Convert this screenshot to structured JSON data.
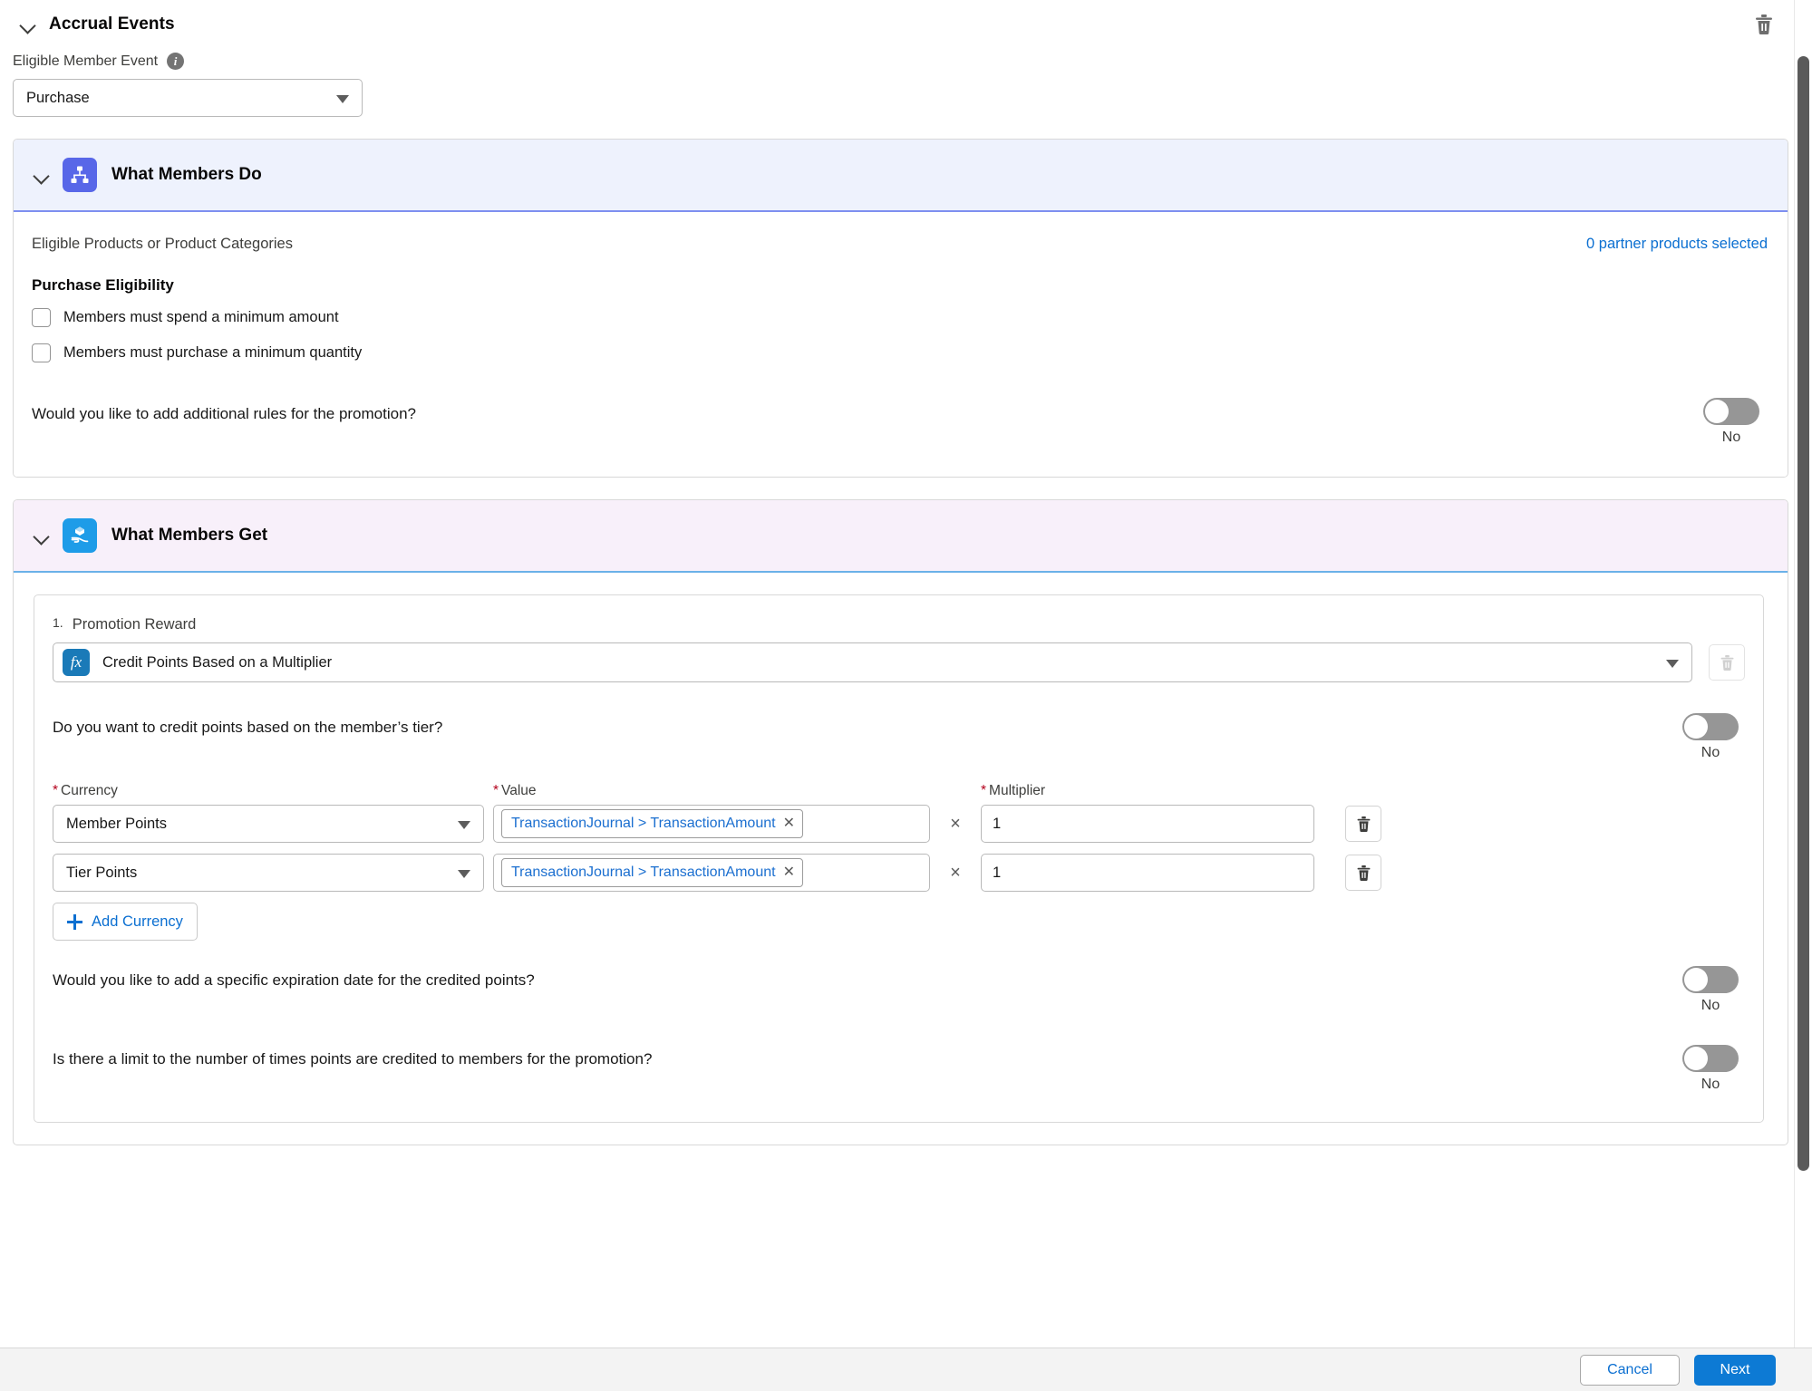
{
  "accrual": {
    "title": "Accrual Events",
    "delete_icon": "trash-icon",
    "chevron_icon": "chevron-down-icon"
  },
  "eligible_member_event": {
    "label": "Eligible Member Event",
    "info_icon": "info-icon",
    "value": "Purchase"
  },
  "what_members_do": {
    "title": "What Members Do",
    "icon": "hierarchy-icon",
    "eligible_products_label": "Eligible Products or Product Categories",
    "partner_products_link": "0 partner products selected",
    "purchase_eligibility_heading": "Purchase Eligibility",
    "checkboxes": [
      {
        "label": "Members must spend a minimum amount",
        "checked": false
      },
      {
        "label": "Members must purchase a minimum quantity",
        "checked": false
      }
    ],
    "additional_rules": {
      "question": "Would you like to add additional rules for the promotion?",
      "state": "No"
    }
  },
  "what_members_get": {
    "title": "What Members Get",
    "icon": "gift-in-hand-icon",
    "reward": {
      "number": "1.",
      "caption": "Promotion Reward",
      "type_icon": "formula-fx-icon",
      "type_value": "Credit Points Based on a Multiplier",
      "delete_icon": "trash-icon",
      "tier_question": "Do you want to credit points based on the member’s tier?",
      "tier_state": "No",
      "columns": {
        "currency": "Currency",
        "value": "Value",
        "multiplier": "Multiplier"
      },
      "rows": [
        {
          "currency": "Member Points",
          "value_token": "TransactionJournal > TransactionAmount",
          "token_remove_icon": "close-icon",
          "times_symbol": "×",
          "multiplier": "1",
          "delete_icon": "trash-icon"
        },
        {
          "currency": "Tier Points",
          "value_token": "TransactionJournal > TransactionAmount",
          "token_remove_icon": "close-icon",
          "times_symbol": "×",
          "multiplier": "1",
          "delete_icon": "trash-icon"
        }
      ],
      "add_currency_label": "Add Currency",
      "add_icon": "plus-icon",
      "expiration": {
        "question": "Would you like to add a specific expiration date for the credited points?",
        "state": "No"
      },
      "limit": {
        "question": "Is there a limit to the number of times points are credited to members for the promotion?",
        "state": "No"
      }
    }
  },
  "footer": {
    "cancel": "Cancel",
    "next": "Next"
  },
  "colors": {
    "link_blue": "#0b6fd1",
    "primary_button": "#0d7ad4",
    "do_accent": "#5867e8",
    "get_accent": "#1e9ce8",
    "required_star": "#b3001b"
  }
}
